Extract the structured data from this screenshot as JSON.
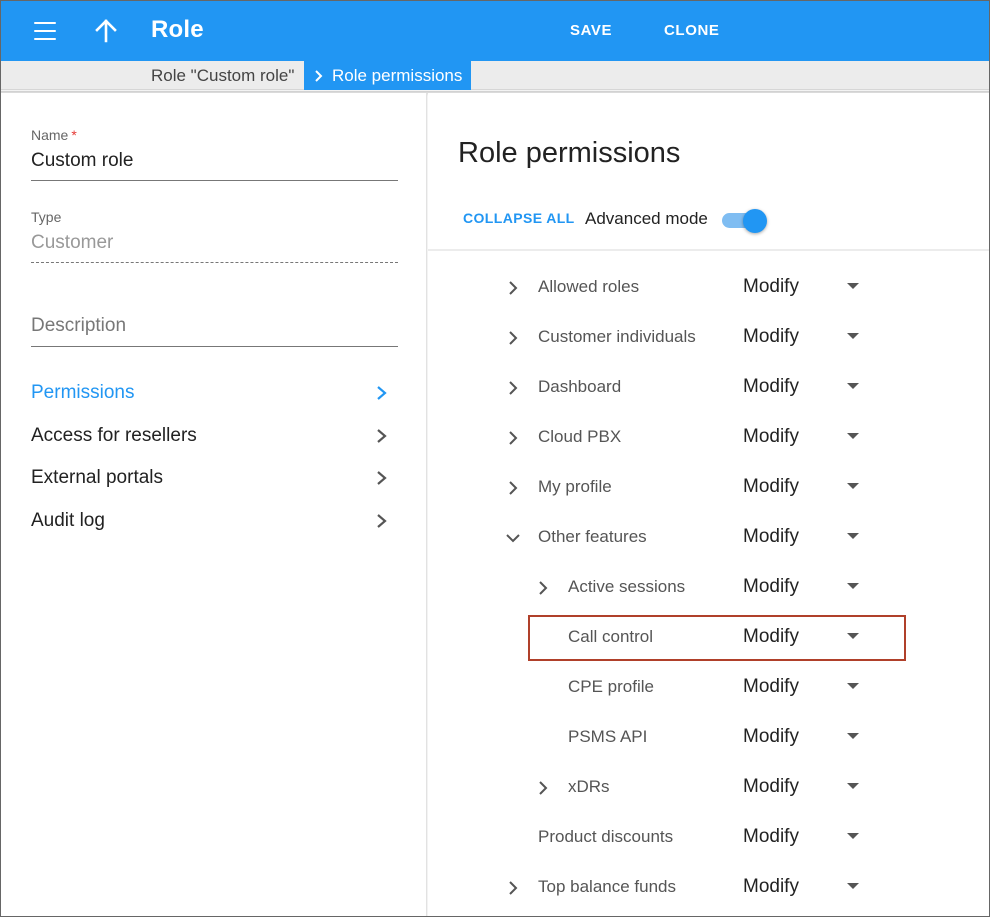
{
  "header": {
    "title": "Role",
    "save_label": "SAVE",
    "clone_label": "CLONE"
  },
  "breadcrumb": {
    "parent": "Role \"Custom role\"",
    "current": "Role permissions"
  },
  "form": {
    "name_label": "Name",
    "name_required": "*",
    "name_value": "Custom role",
    "type_label": "Type",
    "type_value": "Customer",
    "description_placeholder": "Description"
  },
  "nav": {
    "items": [
      {
        "label": "Permissions",
        "active": true
      },
      {
        "label": "Access for resellers",
        "active": false
      },
      {
        "label": "External portals",
        "active": false
      },
      {
        "label": "Audit log",
        "active": false
      }
    ]
  },
  "permissions": {
    "title": "Role permissions",
    "collapse_all": "COLLAPSE ALL",
    "advanced_mode_label": "Advanced mode",
    "advanced_mode_on": true,
    "rows": [
      {
        "label": "Allowed roles",
        "value": "Modify",
        "level": 0,
        "expander": "collapsed"
      },
      {
        "label": "Customer individuals",
        "value": "Modify",
        "level": 0,
        "expander": "collapsed"
      },
      {
        "label": "Dashboard",
        "value": "Modify",
        "level": 0,
        "expander": "collapsed"
      },
      {
        "label": "Cloud PBX",
        "value": "Modify",
        "level": 0,
        "expander": "collapsed"
      },
      {
        "label": "My profile",
        "value": "Modify",
        "level": 0,
        "expander": "collapsed"
      },
      {
        "label": "Other features",
        "value": "Modify",
        "level": 0,
        "expander": "expanded"
      },
      {
        "label": "Active sessions",
        "value": "Modify",
        "level": 1,
        "expander": "collapsed"
      },
      {
        "label": "Call control",
        "value": "Modify",
        "level": 1,
        "expander": "none",
        "highlighted": true
      },
      {
        "label": "CPE profile",
        "value": "Modify",
        "level": 1,
        "expander": "none"
      },
      {
        "label": "PSMS API",
        "value": "Modify",
        "level": 1,
        "expander": "none"
      },
      {
        "label": "xDRs",
        "value": "Modify",
        "level": 1,
        "expander": "collapsed"
      },
      {
        "label": "Product discounts",
        "value": "Modify",
        "level": 0,
        "expander": "none"
      },
      {
        "label": "Top balance funds",
        "value": "Modify",
        "level": 0,
        "expander": "collapsed"
      }
    ]
  },
  "colors": {
    "primary": "#2196f3",
    "highlight_border": "#b0402a",
    "required": "#e53935"
  },
  "icons": {
    "menu": "hamburger-menu-icon",
    "up": "arrow-up-icon",
    "breadcrumb_separator": "chevron-right-icon",
    "expand": "chevron-right-icon",
    "collapse": "chevron-down-icon",
    "dropdown": "triangle-down-icon"
  }
}
